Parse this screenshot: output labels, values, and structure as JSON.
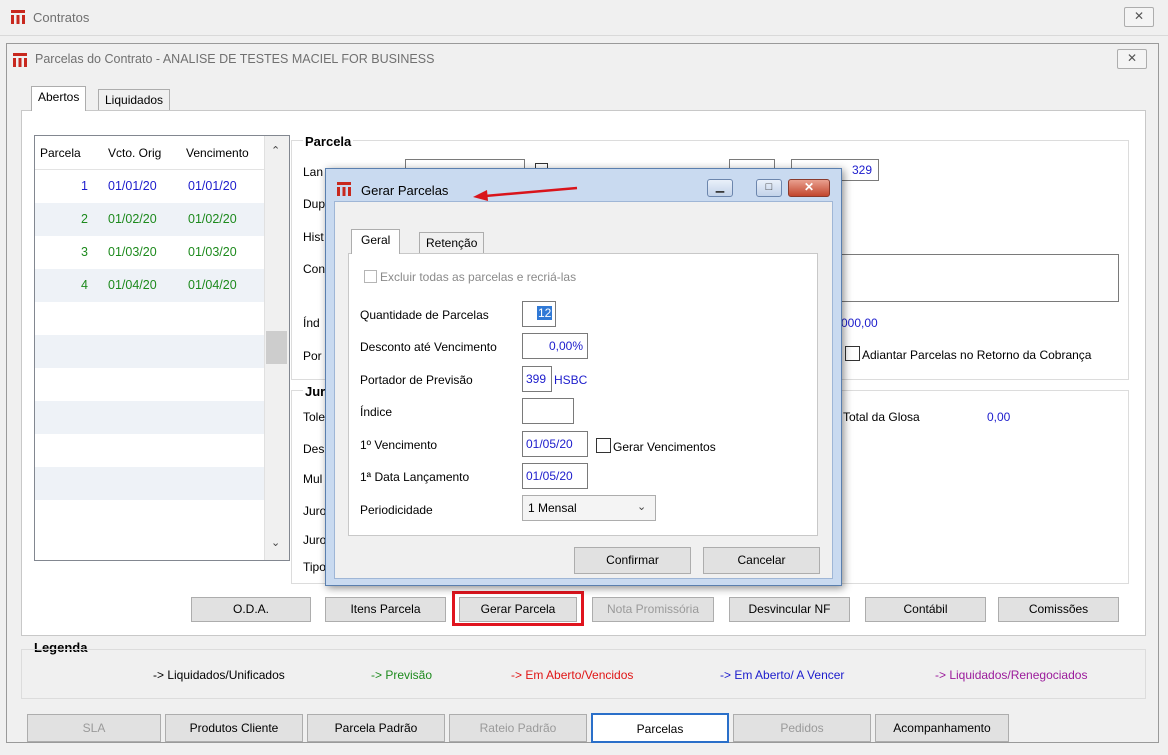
{
  "outer_window": {
    "title": "Contratos",
    "close_label": "✕"
  },
  "inner_window": {
    "title": "Parcelas do Contrato - ANALISE DE TESTES MACIEL FOR BUSINESS",
    "close_label": "✕"
  },
  "tabs": [
    {
      "label": "Abertos"
    },
    {
      "label": "Liquidados"
    }
  ],
  "grid": {
    "headers": [
      "Parcela",
      "Vcto. Orig",
      "Vencimento"
    ],
    "rows": [
      {
        "parcela": "1",
        "vcto_orig": "01/01/20",
        "vencimento": "01/01/20",
        "color": "#1c1ccc"
      },
      {
        "parcela": "2",
        "vcto_orig": "01/02/20",
        "vencimento": "01/02/20",
        "color": "#1d8a1d"
      },
      {
        "parcela": "3",
        "vcto_orig": "01/03/20",
        "vencimento": "01/03/20",
        "color": "#1d8a1d"
      },
      {
        "parcela": "4",
        "vcto_orig": "01/04/20",
        "vencimento": "01/04/20",
        "color": "#1d8a1d"
      }
    ]
  },
  "parcela_section": {
    "title": "Parcela",
    "labels": [
      "Lan",
      "Dup",
      "Hist",
      "Con",
      "Índ",
      "Por"
    ],
    "numero_value": "329",
    "valor_fragment": "000,00",
    "adiantar_label": "Adiantar Parcelas no Retorno da Cobrança"
  },
  "juros_section": {
    "title": "Jur",
    "labels": [
      "Tole",
      "Des",
      "Mul",
      "Juro",
      "Juro",
      "Tipo"
    ],
    "total_glosa_label": "Total da Glosa",
    "total_glosa_value": "0,00"
  },
  "dialog": {
    "title": "Gerar Parcelas",
    "min_label": "▁",
    "max_label": "□",
    "close_label": "✕",
    "tabs": [
      {
        "label": "Geral"
      },
      {
        "label": "Retenção"
      }
    ],
    "excluir_label": "Excluir todas as parcelas e recriá-las",
    "quantidade_label": "Quantidade de Parcelas",
    "quantidade_value": "12",
    "desconto_label": "Desconto até Vencimento",
    "desconto_value": "0,00%",
    "portador_label": "Portador de Previsão",
    "portador_code": "399",
    "portador_name": "HSBC",
    "indice_label": "Índice",
    "indice_value": "",
    "vencimento_label": "1º Vencimento",
    "vencimento_value": "01/05/20",
    "gerar_venc_label": "Gerar Vencimentos",
    "data_lanc_label": "1ª Data Lançamento",
    "data_lanc_value": "01/05/20",
    "periodicidade_label": "Periodicidade",
    "periodicidade_value": "1 Mensal",
    "confirmar_label": "Confirmar",
    "cancelar_label": "Cancelar"
  },
  "action_buttons": [
    {
      "label": "O.D.A."
    },
    {
      "label": "Itens Parcela"
    },
    {
      "label": "Gerar Parcela"
    },
    {
      "label": "Nota Promissória"
    },
    {
      "label": "Desvincular NF"
    },
    {
      "label": "Contábil"
    },
    {
      "label": "Comissões"
    }
  ],
  "legend": {
    "title": "Legenda",
    "items": [
      {
        "label": "-> Liquidados/Unificados",
        "color": "#000000"
      },
      {
        "label": "-> Previsão",
        "color": "#1d8a1d"
      },
      {
        "label": "-> Em Aberto/Vencidos",
        "color": "#e01515"
      },
      {
        "label": "-> Em Aberto/ A Vencer",
        "color": "#1c1ccc"
      },
      {
        "label": "-> Liquidados/Renegociados",
        "color": "#9b1a9b"
      }
    ]
  },
  "bottom_tabs": [
    {
      "label": "SLA"
    },
    {
      "label": "Produtos Cliente"
    },
    {
      "label": "Parcela Padrão"
    },
    {
      "label": "Rateio Padrão"
    },
    {
      "label": "Parcelas"
    },
    {
      "label": "Pedidos"
    },
    {
      "label": "Acompanhamento"
    }
  ],
  "colors": {
    "highlight_red": "#e0141e",
    "arrow_red": "#d9141b",
    "selection_blue": "#3079d6"
  }
}
